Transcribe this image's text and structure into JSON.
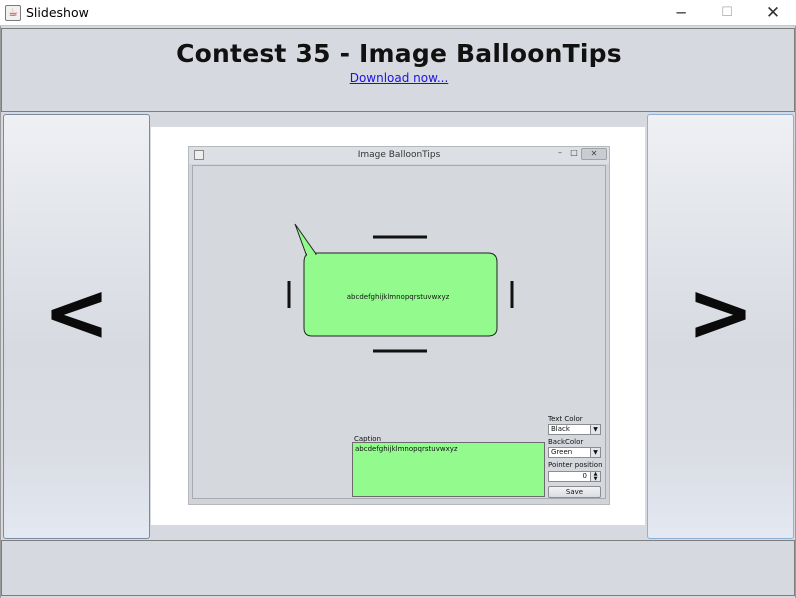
{
  "window": {
    "title": "Slideshow",
    "icon": "java-cup-icon",
    "controls": {
      "minimize": "─",
      "maximize": "☐",
      "close": "✕"
    }
  },
  "header": {
    "title": "Contest 35 - Image BalloonTips",
    "download_link": "Download now..."
  },
  "navigation": {
    "prev_label": "<",
    "next_label": ">"
  },
  "slide": {
    "window_title": "Image BalloonTips",
    "balloon_text": "abcdefghijklmnopqrstuvwxyz",
    "caption_label": "Caption",
    "caption_text": "abcdefghijklmnopqrstuvwxyz",
    "text_color_label": "Text Color",
    "text_color_value": "Black",
    "back_color_label": "BackColor",
    "back_color_value": "Green",
    "pointer_position_label": "Pointer position",
    "pointer_position_value": "0",
    "save_label": "Save",
    "colors": {
      "balloon_fill": "#93fb8e",
      "panel": "#d5d8dd"
    }
  }
}
